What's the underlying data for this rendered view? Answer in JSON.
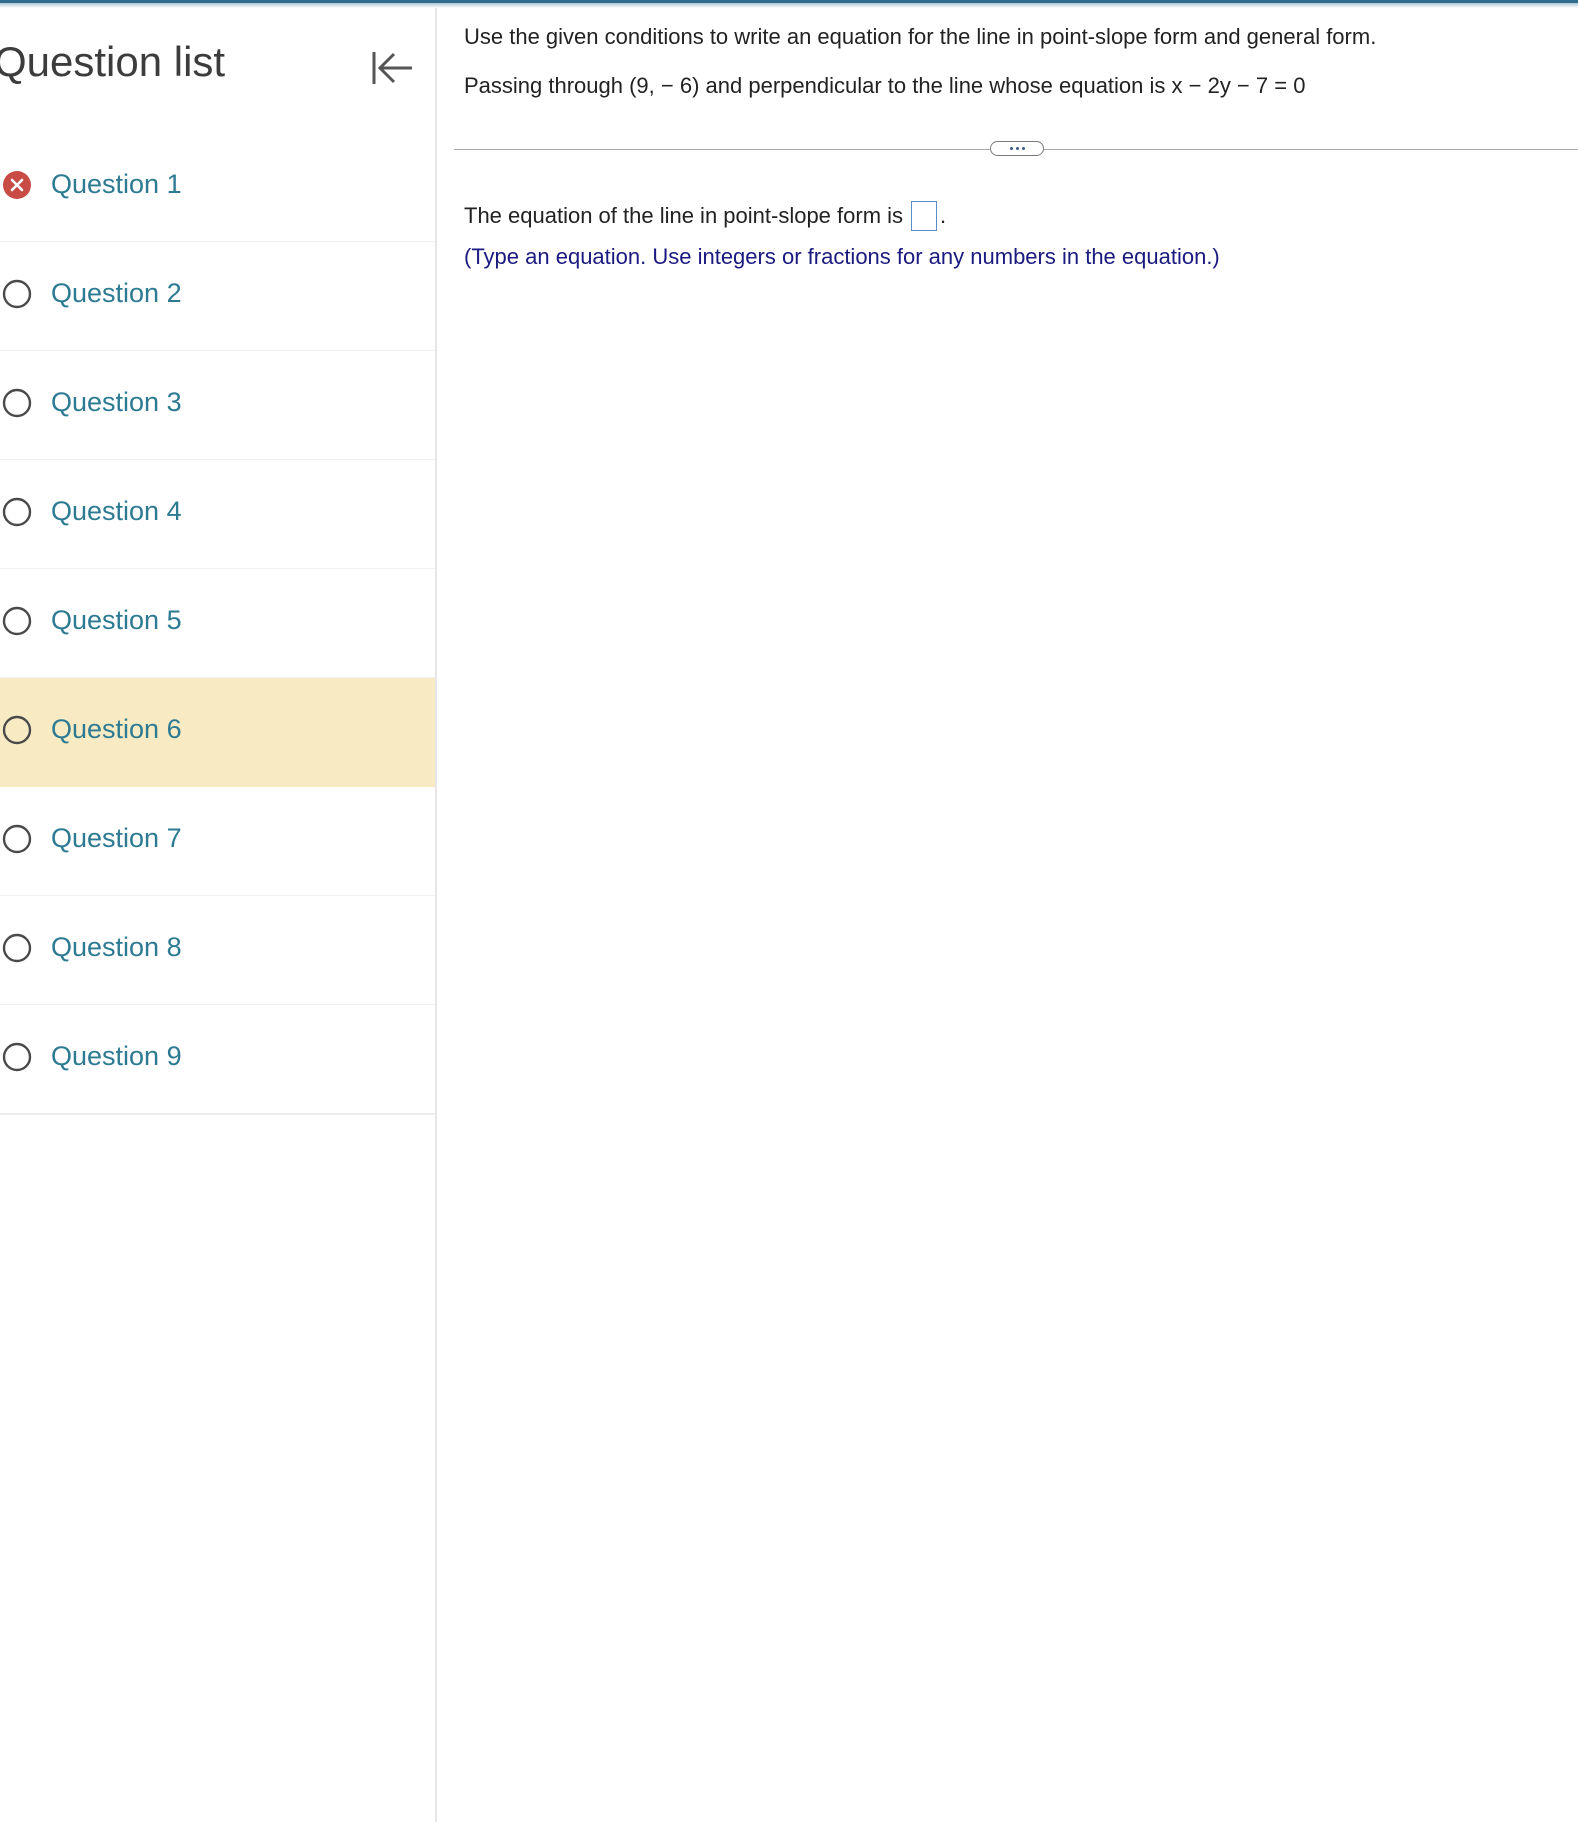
{
  "sidebar": {
    "title": "Question list",
    "collapse_icon": "collapse-left-arrow-icon",
    "items": [
      {
        "label": "Question 1",
        "status": "incorrect"
      },
      {
        "label": "Question 2",
        "status": "unanswered"
      },
      {
        "label": "Question 3",
        "status": "unanswered"
      },
      {
        "label": "Question 4",
        "status": "unanswered"
      },
      {
        "label": "Question 5",
        "status": "unanswered"
      },
      {
        "label": "Question 6",
        "status": "unanswered",
        "active": true
      },
      {
        "label": "Question 7",
        "status": "unanswered"
      },
      {
        "label": "Question 8",
        "status": "unanswered"
      },
      {
        "label": "Question 9",
        "status": "unanswered"
      }
    ]
  },
  "question": {
    "prompt": "Use the given conditions to write an equation for the line in point-slope form and general form.",
    "condition": "Passing through (9, − 6) and perpendicular to the line whose equation is x − 2y − 7 = 0",
    "answer_label": "The equation of the line in point-slope form is",
    "answer_suffix": ".",
    "answer_value": "",
    "hint": "(Type an equation. Use integers or fractions for any numbers in the equation.)"
  },
  "colors": {
    "link_teal": "#2d7a93",
    "active_row": "#f8ebc4",
    "incorrect_red": "#c94b45",
    "hint_navy": "#1a1a80",
    "input_border": "#5b8ac9"
  }
}
